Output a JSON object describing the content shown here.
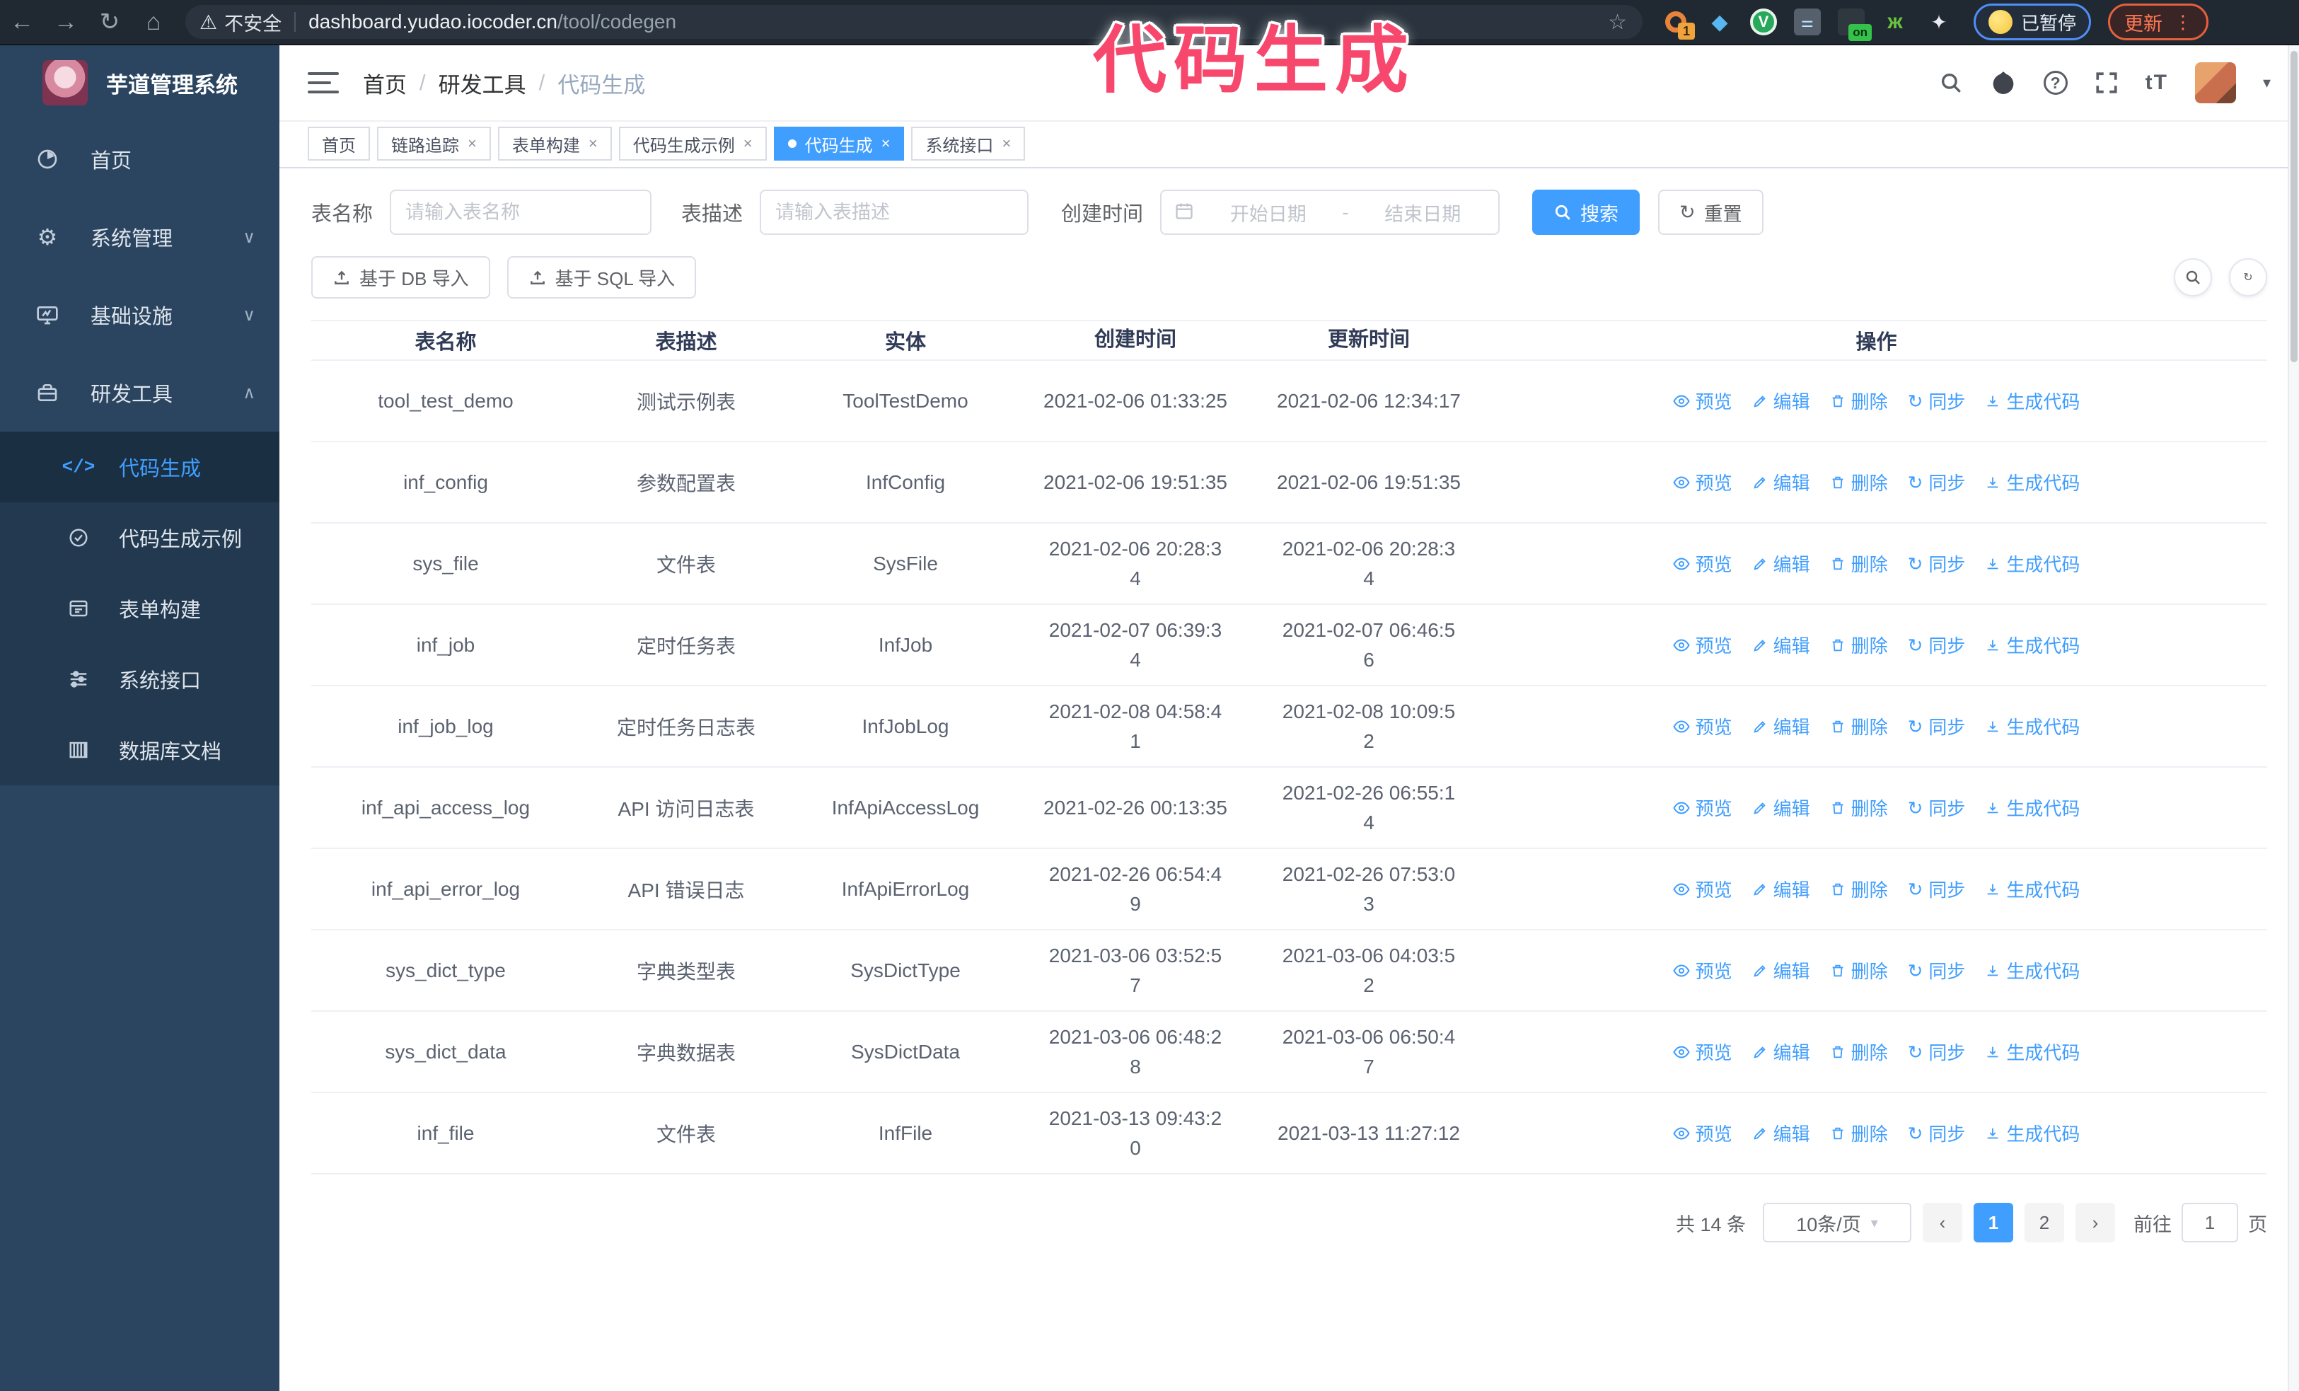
{
  "browser": {
    "security_warning": "不安全",
    "url_host": "dashboard.yudao.iocoder.cn",
    "url_path": "/tool/codegen",
    "extension_badge": "1",
    "on_badge": "on",
    "paused_badge": "已暂停",
    "update_button": "更新"
  },
  "annotation": {
    "text": "代码生成",
    "color": "#f8476d"
  },
  "icons": {
    "back_glyph": "←",
    "forward_glyph": "→",
    "reload_glyph": "↻",
    "home_glyph": "⌂",
    "warning_glyph": "⚠",
    "star_glyph": "☆",
    "gem_glyph": "◆",
    "v_glyph": "V",
    "sliders_glyph": "⚌",
    "alien_glyph": "ж",
    "puzzle_glyph": "✦",
    "dots_glyph": "⋮",
    "gear_glyph": "⚙",
    "code_glyph": "</>",
    "close_glyph": "×",
    "caret_glyph": "▾",
    "chev_down": "∨",
    "chev_up": "∧",
    "breadcrumb_sep": "/",
    "help_glyph": "?",
    "font_size_glyph": "tT",
    "sync_glyph": "↻",
    "reset_glyph": "↻",
    "prev_glyph": "‹",
    "next_glyph": "›"
  },
  "sidebar": {
    "title": "芋道管理系统",
    "items": [
      {
        "label": "首页"
      },
      {
        "label": "系统管理"
      },
      {
        "label": "基础设施"
      },
      {
        "label": "研发工具"
      }
    ],
    "subitems": [
      {
        "label": "代码生成"
      },
      {
        "label": "代码生成示例"
      },
      {
        "label": "表单构建"
      },
      {
        "label": "系统接口"
      },
      {
        "label": "数据库文档"
      }
    ]
  },
  "navbar": {
    "breadcrumb": [
      "首页",
      "研发工具",
      "代码生成"
    ]
  },
  "tabs": [
    {
      "label": "首页"
    },
    {
      "label": "链路追踪"
    },
    {
      "label": "表单构建"
    },
    {
      "label": "代码生成示例"
    },
    {
      "label": "代码生成"
    },
    {
      "label": "系统接口"
    }
  ],
  "filters": {
    "name_label": "表名称",
    "name_placeholder": "请输入表名称",
    "desc_label": "表描述",
    "desc_placeholder": "请输入表描述",
    "time_label": "创建时间",
    "start_placeholder": "开始日期",
    "range_separator": "-",
    "end_placeholder": "结束日期",
    "search_label": "搜索",
    "reset_label": "重置"
  },
  "toolbar": {
    "import_db_label": "基于 DB 导入",
    "import_sql_label": "基于 SQL 导入"
  },
  "table": {
    "headers": [
      "表名称",
      "表描述",
      "实体",
      "创建时间",
      "更新时间",
      "操作"
    ],
    "actions": [
      "预览",
      "编辑",
      "删除",
      "同步",
      "生成代码"
    ],
    "rows": [
      [
        "tool_test_demo",
        "测试示例表",
        "ToolTestDemo",
        "2021-02-06 01:33:25",
        "2021-02-06 12:34:17"
      ],
      [
        "inf_config",
        "参数配置表",
        "InfConfig",
        "2021-02-06 19:51:35",
        "2021-02-06 19:51:35"
      ],
      [
        "sys_file",
        "文件表",
        "SysFile",
        "2021-02-06 20:28:3\n4",
        "2021-02-06 20:28:3\n4"
      ],
      [
        "inf_job",
        "定时任务表",
        "InfJob",
        "2021-02-07 06:39:3\n4",
        "2021-02-07 06:46:5\n6"
      ],
      [
        "inf_job_log",
        "定时任务日志表",
        "InfJobLog",
        "2021-02-08 04:58:4\n1",
        "2021-02-08 10:09:5\n2"
      ],
      [
        "inf_api_access_log",
        "API 访问日志表",
        "InfApiAccessLog",
        "2021-02-26 00:13:35",
        "2021-02-26 06:55:1\n4"
      ],
      [
        "inf_api_error_log",
        "API 错误日志",
        "InfApiErrorLog",
        "2021-02-26 06:54:4\n9",
        "2021-02-26 07:53:0\n3"
      ],
      [
        "sys_dict_type",
        "字典类型表",
        "SysDictType",
        "2021-03-06 03:52:5\n7",
        "2021-03-06 04:03:5\n2"
      ],
      [
        "sys_dict_data",
        "字典数据表",
        "SysDictData",
        "2021-03-06 06:48:2\n8",
        "2021-03-06 06:50:4\n7"
      ],
      [
        "inf_file",
        "文件表",
        "InfFile",
        "2021-03-13 09:43:2\n0",
        "2021-03-13 11:27:12"
      ]
    ]
  },
  "pagination": {
    "total": "共 14 条",
    "page_size": "10条/页",
    "pages": [
      "1",
      "2"
    ],
    "goto_label": "前往",
    "goto_value": "1",
    "page_unit": "页"
  }
}
